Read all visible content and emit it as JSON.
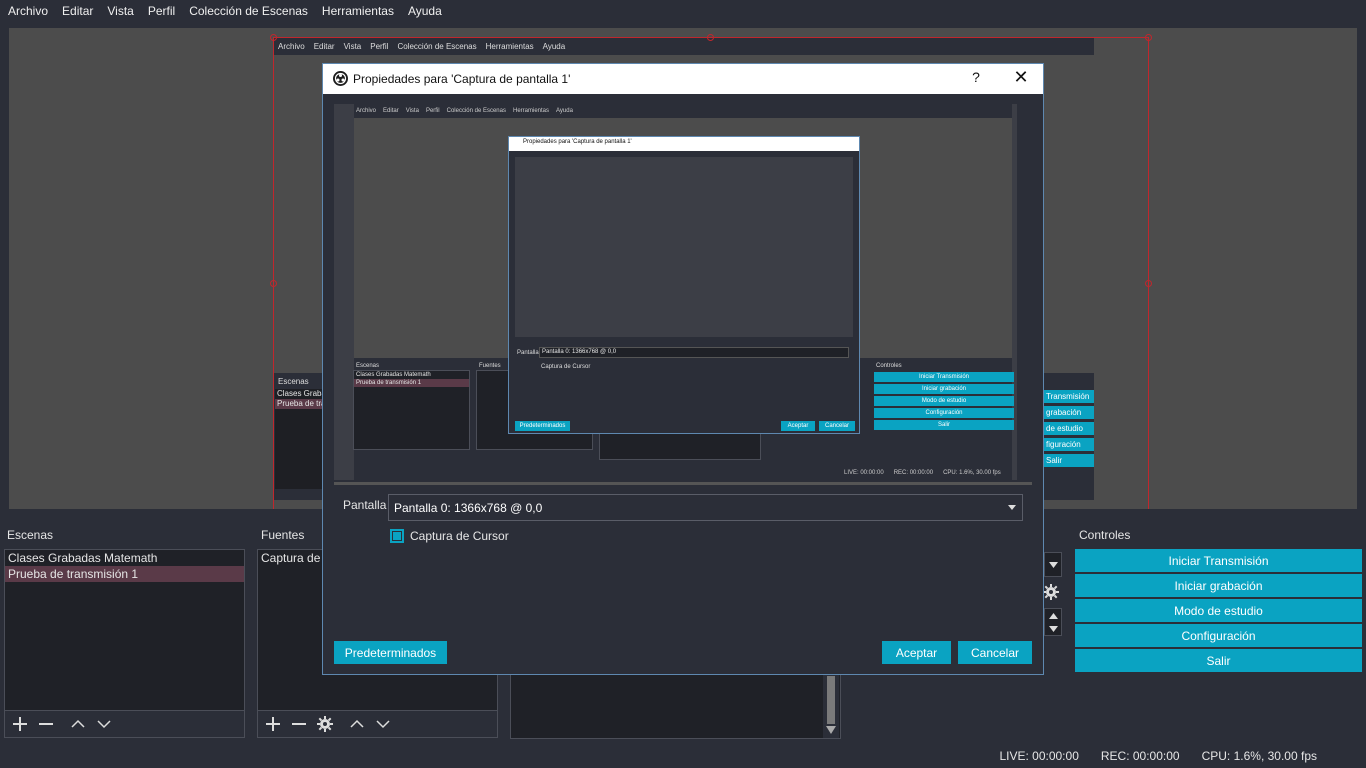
{
  "menubar": {
    "items": [
      "Archivo",
      "Editar",
      "Vista",
      "Perfil",
      "Colección de Escenas",
      "Herramientas",
      "Ayuda"
    ]
  },
  "preview": {
    "inner_menu": [
      "Archivo",
      "Editar",
      "Vista",
      "Perfil",
      "Colección de Escenas",
      "Herramientas",
      "Ayuda"
    ],
    "inner_scenes_title": "Escenas",
    "inner_scenes": [
      "Clases Grabad",
      "Prueba de trans"
    ],
    "inner_controls": [
      "Transmisión",
      "grabación",
      "de estudio",
      "figuración",
      "Salir"
    ]
  },
  "scenes": {
    "title": "Escenas",
    "items": [
      "Clases Grabadas Matemath",
      "Prueba de transmisión 1"
    ],
    "selected_index": 1
  },
  "sources": {
    "title": "Fuentes",
    "items": [
      "Captura de p"
    ]
  },
  "controls": {
    "title": "Controles",
    "buttons": [
      "Iniciar Transmisión",
      "Iniciar grabación",
      "Modo de estudio",
      "Configuración",
      "Salir"
    ]
  },
  "status": {
    "live": "LIVE: 00:00:00",
    "rec": "REC: 00:00:00",
    "cpu": "CPU: 1.6%, 30.00 fps"
  },
  "dialog": {
    "title": "Propiedades para 'Captura de pantalla 1'",
    "help": "?",
    "close": "✕",
    "screen_label": "Pantalla",
    "screen_value": "Pantalla 0: 1366x768 @ 0,0",
    "cursor_label": "Captura de Cursor",
    "cursor_checked": true,
    "defaults_button": "Predeterminados",
    "ok_button": "Aceptar",
    "cancel_button": "Cancelar",
    "preview": {
      "menu": [
        "Archivo",
        "Editar",
        "Vista",
        "Perfil",
        "Colección de Escenas",
        "Herramientas",
        "Ayuda"
      ],
      "scenes_title": "Escenas",
      "scenes": [
        "Clases Grabadas Matemath",
        "Prueba de transmisión 1"
      ],
      "sources_title": "Fuentes",
      "controls_title": "Controles",
      "controls": [
        "Iniciar Transmisión",
        "Iniciar grabación",
        "Modo de estudio",
        "Configuración",
        "Salir"
      ],
      "status": [
        "LIVE: 00:00:00",
        "REC: 00:00:00",
        "CPU: 1.6%, 30.00 fps"
      ],
      "nested_title": "Propiedades para 'Captura de pantalla 1'",
      "nested_label": "Pantalla",
      "nested_value": "Pantalla 0: 1366x768 @ 0,0",
      "nested_check": "Captura de Cursor",
      "nested_defaults": "Predeterminados",
      "nested_ok": "Aceptar",
      "nested_cancel": "Cancelar"
    }
  },
  "colors": {
    "accent": "#0aa3c2",
    "selected": "#5a3a48",
    "frame": "#c0272d"
  }
}
